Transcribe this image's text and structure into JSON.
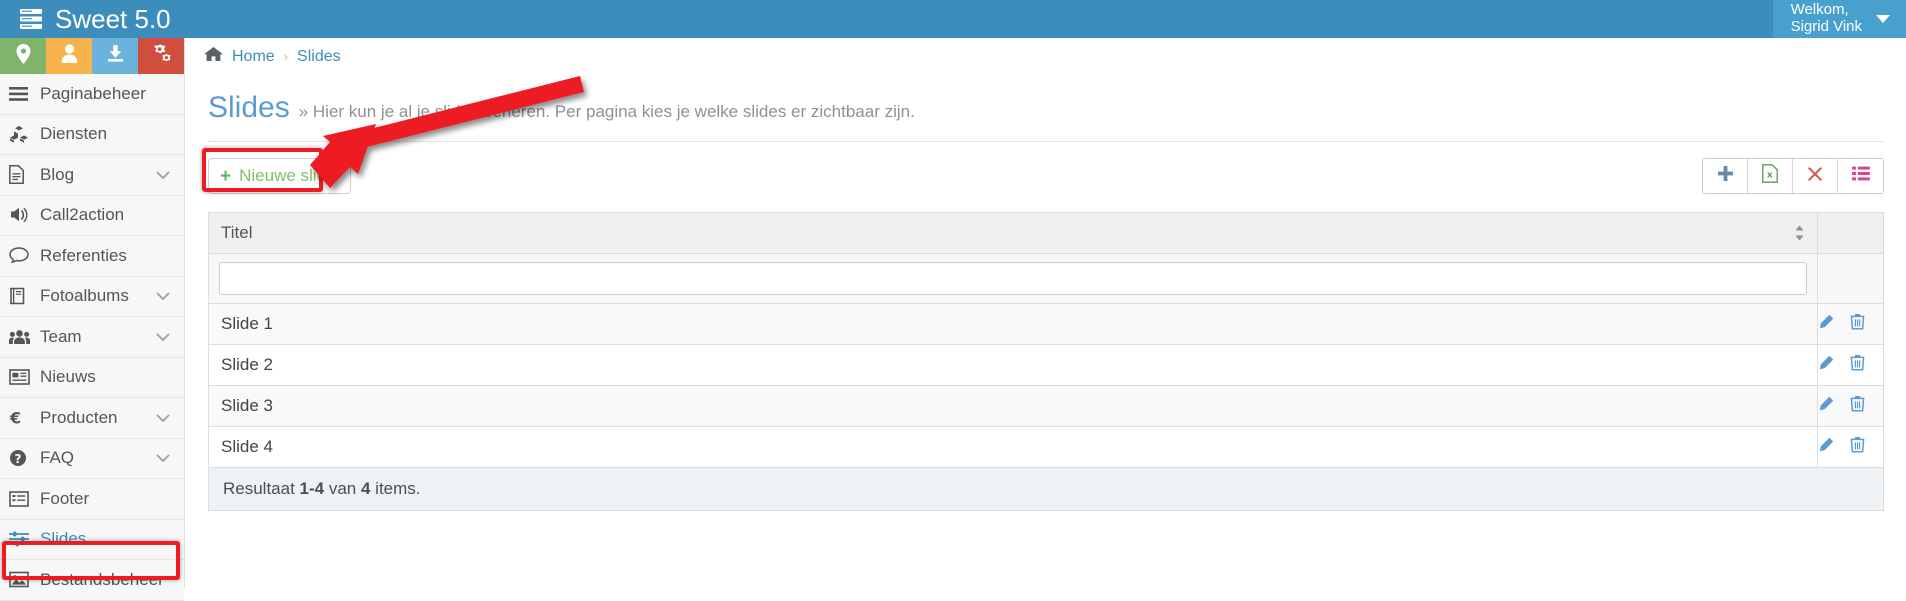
{
  "app": {
    "brand": "Sweet 5.0",
    "brand_icon": "server-stack-icon"
  },
  "user": {
    "greeting": "Welkom,",
    "name": "Sigrid Vink",
    "caret_icon": "caret-down-icon"
  },
  "sidebar": {
    "quick_actions": [
      {
        "name": "location-quick-action",
        "icon": "map-marker-icon",
        "color": "#80b46a"
      },
      {
        "name": "user-quick-action",
        "icon": "user-icon",
        "color": "#f6b34b"
      },
      {
        "name": "download-quick-action",
        "icon": "download-icon",
        "color": "#6bb3dd"
      },
      {
        "name": "settings-quick-action",
        "icon": "gears-icon",
        "color": "#cf4e3e"
      }
    ],
    "items": [
      {
        "label": "Paginabeheer",
        "icon": "bars-icon",
        "expandable": false,
        "active": false
      },
      {
        "label": "Diensten",
        "icon": "cubes-icon",
        "expandable": false,
        "active": false
      },
      {
        "label": "Blog",
        "icon": "file-text-icon",
        "expandable": true,
        "active": false
      },
      {
        "label": "Call2action",
        "icon": "bullhorn-icon",
        "expandable": false,
        "active": false
      },
      {
        "label": "Referenties",
        "icon": "comment-icon",
        "expandable": false,
        "active": false
      },
      {
        "label": "Fotoalbums",
        "icon": "book-icon",
        "expandable": true,
        "active": false
      },
      {
        "label": "Team",
        "icon": "users-icon",
        "expandable": true,
        "active": false
      },
      {
        "label": "Nieuws",
        "icon": "newspaper-icon",
        "expandable": false,
        "active": false
      },
      {
        "label": "Producten",
        "icon": "euro-icon",
        "expandable": true,
        "active": false
      },
      {
        "label": "FAQ",
        "icon": "question-icon",
        "expandable": true,
        "active": false
      },
      {
        "label": "Footer",
        "icon": "list-alt-icon",
        "expandable": false,
        "active": false
      },
      {
        "label": "Slides",
        "icon": "sliders-icon",
        "expandable": false,
        "active": true
      },
      {
        "label": "Bestandsbeheer",
        "icon": "image-icon",
        "expandable": false,
        "active": false
      }
    ]
  },
  "breadcrumb": {
    "home_icon": "home-icon",
    "home": "Home",
    "separator": "›",
    "current": "Slides"
  },
  "page": {
    "title": "Slides",
    "subtitle": "» Hier kun je al je slides beheren. Per pagina kies je welke slides er zichtbaar zijn."
  },
  "toolbar": {
    "new_label": "Nieuwe slide",
    "new_icon": "plus-icon",
    "buttons": [
      {
        "name": "add-button",
        "icon": "plus-icon",
        "color": "#6a8aa0"
      },
      {
        "name": "export-button",
        "icon": "excel-file-icon",
        "color": "#5a9e4e"
      },
      {
        "name": "delete-button",
        "icon": "times-icon",
        "color": "#d9534f"
      },
      {
        "name": "columns-button",
        "icon": "list-icon",
        "color": "#d9478e"
      }
    ]
  },
  "table": {
    "columns": [
      "Titel"
    ],
    "sort_icon": "sort-icon",
    "filter_value": "",
    "filter_placeholder": "",
    "rows": [
      {
        "title": "Slide 1"
      },
      {
        "title": "Slide 2"
      },
      {
        "title": "Slide 3"
      },
      {
        "title": "Slide 4"
      }
    ],
    "row_actions": [
      {
        "name": "edit-row-button",
        "icon": "pencil-icon"
      },
      {
        "name": "delete-row-button",
        "icon": "trash-icon"
      }
    ],
    "summary": {
      "prefix": "Resultaat ",
      "range": "1-4",
      "middle": " van ",
      "count": "4",
      "suffix": " items."
    }
  },
  "annotations": {
    "arrow_color": "#ed1c24",
    "highlight_color": "#ed1c24"
  }
}
